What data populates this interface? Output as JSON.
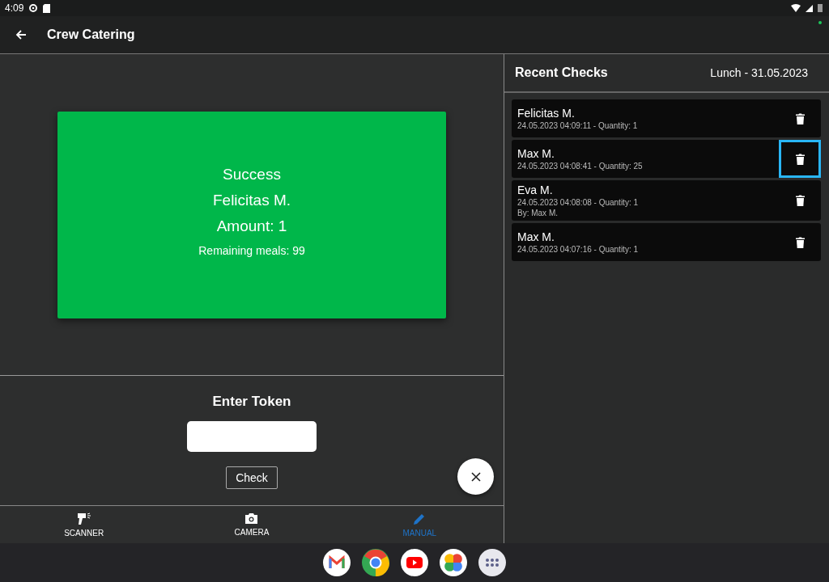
{
  "status_bar": {
    "time": "4:09"
  },
  "app_bar": {
    "title": "Crew Catering"
  },
  "result_card": {
    "kind": "success",
    "title": "Success",
    "name": "Felicitas M.",
    "amount": "Amount: 1",
    "remaining": "Remaining meals: 99"
  },
  "token_form": {
    "label": "Enter Token",
    "button": "Check"
  },
  "bottom_nav": [
    {
      "label": "SCANNER",
      "kind": "scanner",
      "selected": false
    },
    {
      "label": "CAMERA",
      "kind": "camera",
      "selected": false
    },
    {
      "label": "MANUAL",
      "kind": "manual",
      "selected": true
    }
  ],
  "recent_checks": {
    "title": "Recent Checks",
    "meal": "Lunch - 31.05.2023",
    "items": [
      {
        "name": "Felicitas M.",
        "details": "24.05.2023 04:09:11 - Quantity: 1",
        "focused": false
      },
      {
        "name": "Max M.",
        "details": "24.05.2023 04:08:41 - Quantity: 25",
        "focused": true
      },
      {
        "name": "Eva M.",
        "details": "24.05.2023 04:08:08 - Quantity: 1",
        "by": "By: Max M.",
        "focused": false
      },
      {
        "name": "Max M.",
        "details": "24.05.2023 04:07:16 - Quantity: 1",
        "focused": false
      }
    ]
  }
}
